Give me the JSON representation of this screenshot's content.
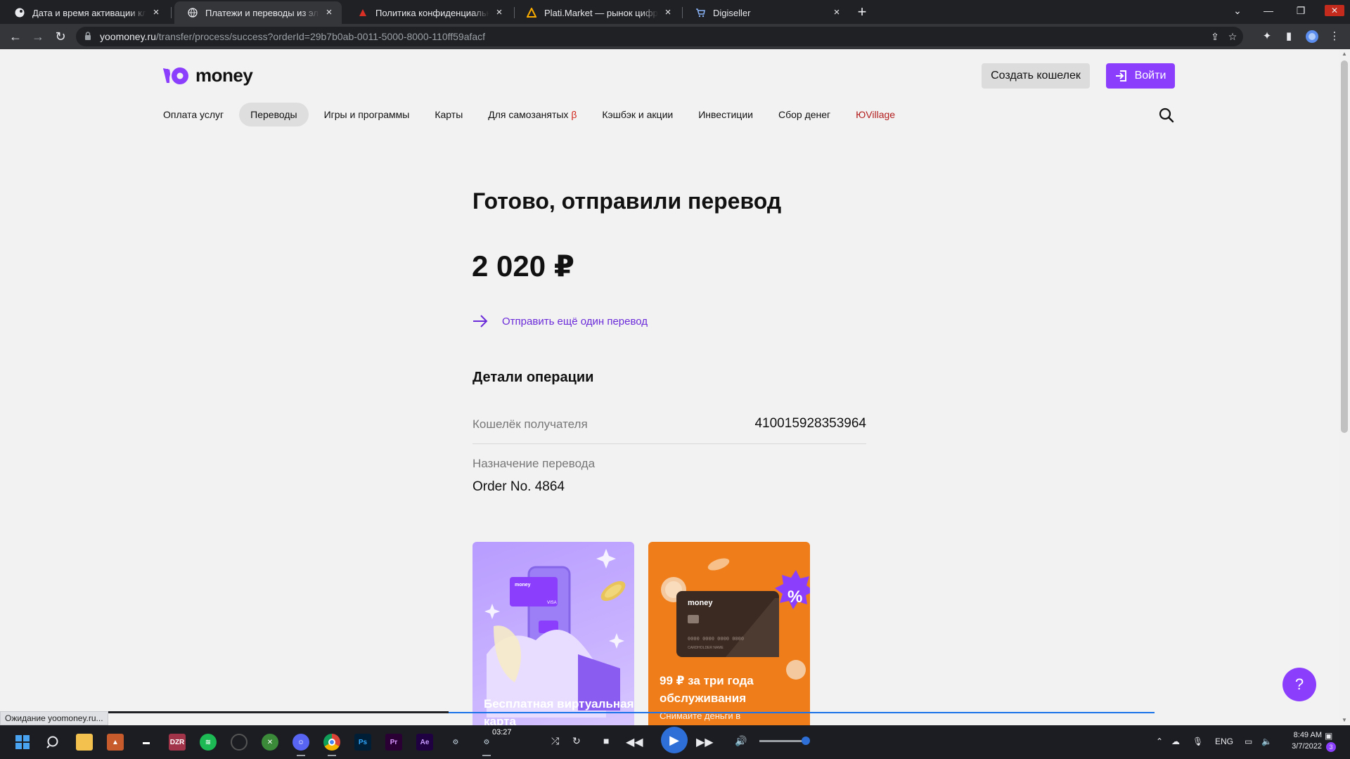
{
  "browser": {
    "tabs": [
      {
        "title": "Дата и время активации ключа",
        "active": false
      },
      {
        "title": "Платежи и переводы из электр",
        "active": true
      },
      {
        "title": "Политика конфиденциальности",
        "active": false
      },
      {
        "title": "Plati.Market — рынок цифровых",
        "active": false
      },
      {
        "title": "Digiseller",
        "active": false
      }
    ],
    "url_host": "yoomoney.ru",
    "url_path": "/transfer/process/success?orderId=29b7b0ab-0011-5000-8000-110ff59afacf",
    "status_text": "Ожидание yoomoney.ru..."
  },
  "site": {
    "logo_text": "money",
    "create_wallet_label": "Создать кошелек",
    "login_label": "Войти",
    "nav": [
      {
        "label": "Оплата услуг"
      },
      {
        "label": "Переводы",
        "active": true
      },
      {
        "label": "Игры и программы"
      },
      {
        "label": "Карты"
      },
      {
        "label": "Для самозанятых",
        "beta": "β"
      },
      {
        "label": "Кэшбэк и акции"
      },
      {
        "label": "Инвестиции"
      },
      {
        "label": "Сбор денег"
      },
      {
        "label": "ЮVillage",
        "red": true
      }
    ]
  },
  "main": {
    "title": "Готово, отправили перевод",
    "amount": "2 020 ₽",
    "send_more": "Отправить ещё один перевод",
    "details_heading": "Детали операции",
    "recipient_label": "Кошелёк получателя",
    "recipient_value": "410015928353964",
    "purpose_label": "Назначение перевода",
    "purpose_value": "Order No. 4864"
  },
  "promo": [
    {
      "title": "Бесплатная виртуальная карта",
      "card_logo": "money",
      "card_brand": "VISA"
    },
    {
      "title": "99 ₽ за три года обслуживания",
      "subtitle": "Снимайте деньги в",
      "card_logo": "money",
      "card_holder": "CARDHOLDER NAME",
      "card_number": "0000 0000 0000 0000",
      "badge": "%"
    }
  ],
  "help_label": "?",
  "taskbar": {
    "media_time": "03:27",
    "lang": "ENG",
    "time": "8:49 AM",
    "date": "3/7/2022",
    "notifications": "3",
    "apps": [
      "start",
      "search",
      "explorer",
      "app-a",
      "app-b",
      "deezer",
      "spotify",
      "app-c",
      "xbox",
      "discord",
      "chrome",
      "photoshop",
      "premiere",
      "after-effects",
      "steam",
      "steam-2"
    ],
    "dzr_label": "DZR",
    "ps_label": "Ps",
    "pr_label": "Pr",
    "ae_label": "Ae"
  },
  "colors": {
    "brand_purple": "#8b3ffd",
    "link_purple": "#6b2bd9",
    "promo_orange": "#ef7e1a",
    "page_bg": "#f2f2f2"
  }
}
